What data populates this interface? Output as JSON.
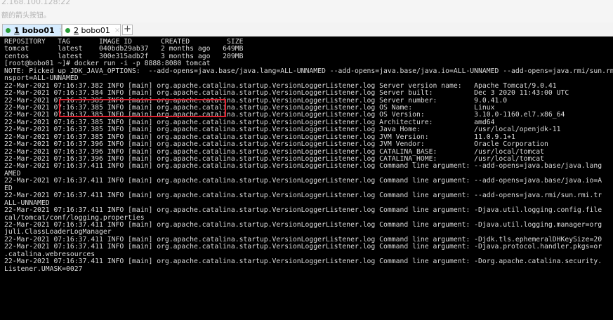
{
  "window": {
    "ip_text": "2.168.100.128:22",
    "hint_text": "额的箭头按钮。"
  },
  "tabs": [
    {
      "num": "1",
      "name": " bobo01",
      "close": "×"
    },
    {
      "num": "2",
      "name": " bobo01",
      "close": "×"
    }
  ],
  "add_tab_label": "+",
  "colors": {
    "status_dot": "#2a9d3a",
    "highlight_box": "#e0212f",
    "active_tab": "#d6ecff"
  },
  "terminal": {
    "lines": [
      "REPOSITORY   TAG       IMAGE ID       CREATED         SIZE",
      "tomcat       latest    040bdb29ab37   2 months ago   649MB",
      "centos       latest    300e315adb2f   3 months ago   209MB",
      "[root@bobo01 ~]# docker run -i -p 8888:8080 tomcat",
      "NOTE: Picked up JDK_JAVA_OPTIONS:  --add-opens=java.base/java.lang=ALL-UNNAMED --add-opens=java.base/java.io=ALL-UNNAMED --add-opens=java.rmi/sun.rmi.tra",
      "nsport=ALL-UNNAMED",
      "22-Mar-2021 07:16:37.382 INFO [main] org.apache.catalina.startup.VersionLoggerListener.log Server version name:   Apache Tomcat/9.0.41",
      "22-Mar-2021 07:16:37.384 INFO [main] org.apache.catalina.startup.VersionLoggerListener.log Server built:          Dec 3 2020 11:43:00 UTC",
      "22-Mar-2021 07:16:37.385 INFO [main] org.apache.catalina.startup.VersionLoggerListener.log Server number:         9.0.41.0",
      "22-Mar-2021 07:16:37.385 INFO [main] org.apache.catalina.startup.VersionLoggerListener.log OS Name:               Linux",
      "22-Mar-2021 07:16:37.385 INFO [main] org.apache.catalina.startup.VersionLoggerListener.log OS Version:            3.10.0-1160.el7.x86_64",
      "22-Mar-2021 07:16:37.385 INFO [main] org.apache.catalina.startup.VersionLoggerListener.log Architecture:          amd64",
      "22-Mar-2021 07:16:37.385 INFO [main] org.apache.catalina.startup.VersionLoggerListener.log Java Home:             /usr/local/openjdk-11",
      "22-Mar-2021 07:16:37.385 INFO [main] org.apache.catalina.startup.VersionLoggerListener.log JVM Version:           11.0.9.1+1",
      "22-Mar-2021 07:16:37.396 INFO [main] org.apache.catalina.startup.VersionLoggerListener.log JVM Vendor:            Oracle Corporation",
      "22-Mar-2021 07:16:37.396 INFO [main] org.apache.catalina.startup.VersionLoggerListener.log CATALINA_BASE:         /usr/local/tomcat",
      "22-Mar-2021 07:16:37.396 INFO [main] org.apache.catalina.startup.VersionLoggerListener.log CATALINA_HOME:         /usr/local/tomcat",
      "22-Mar-2021 07:16:37.411 INFO [main] org.apache.catalina.startup.VersionLoggerListener.log Command line argument: --add-opens=java.base/java.lang",
      "AMED",
      "22-Mar-2021 07:16:37.411 INFO [main] org.apache.catalina.startup.VersionLoggerListener.log Command line argument: --add-opens=java.base/java.io=A",
      "ED",
      "22-Mar-2021 07:16:37.411 INFO [main] org.apache.catalina.startup.VersionLoggerListener.log Command line argument: --add-opens=java.rmi/sun.rmi.tr",
      "ALL-UNNAMED",
      "22-Mar-2021 07:16:37.411 INFO [main] org.apache.catalina.startup.VersionLoggerListener.log Command line argument: -Djava.util.logging.config.file",
      "cal/tomcat/conf/logging.properties",
      "22-Mar-2021 07:16:37.411 INFO [main] org.apache.catalina.startup.VersionLoggerListener.log Command line argument: -Djava.util.logging.manager=org",
      "juli.ClassLoaderLogManager",
      "22-Mar-2021 07:16:37.411 INFO [main] org.apache.catalina.startup.VersionLoggerListener.log Command line argument: -Djdk.tls.ephemeralDHKeySize=20",
      "22-Mar-2021 07:16:37.411 INFO [main] org.apache.catalina.startup.VersionLoggerListener.log Command line argument: -Djava.protocol.handler.pkgs=or",
      ".catalina.webresources",
      "22-Mar-2021 07:16:37.411 INFO [main] org.apache.catalina.startup.VersionLoggerListener.log Command line argument: -Dorg.apache.catalina.security.",
      "Listener.UMASK=0027"
    ]
  }
}
